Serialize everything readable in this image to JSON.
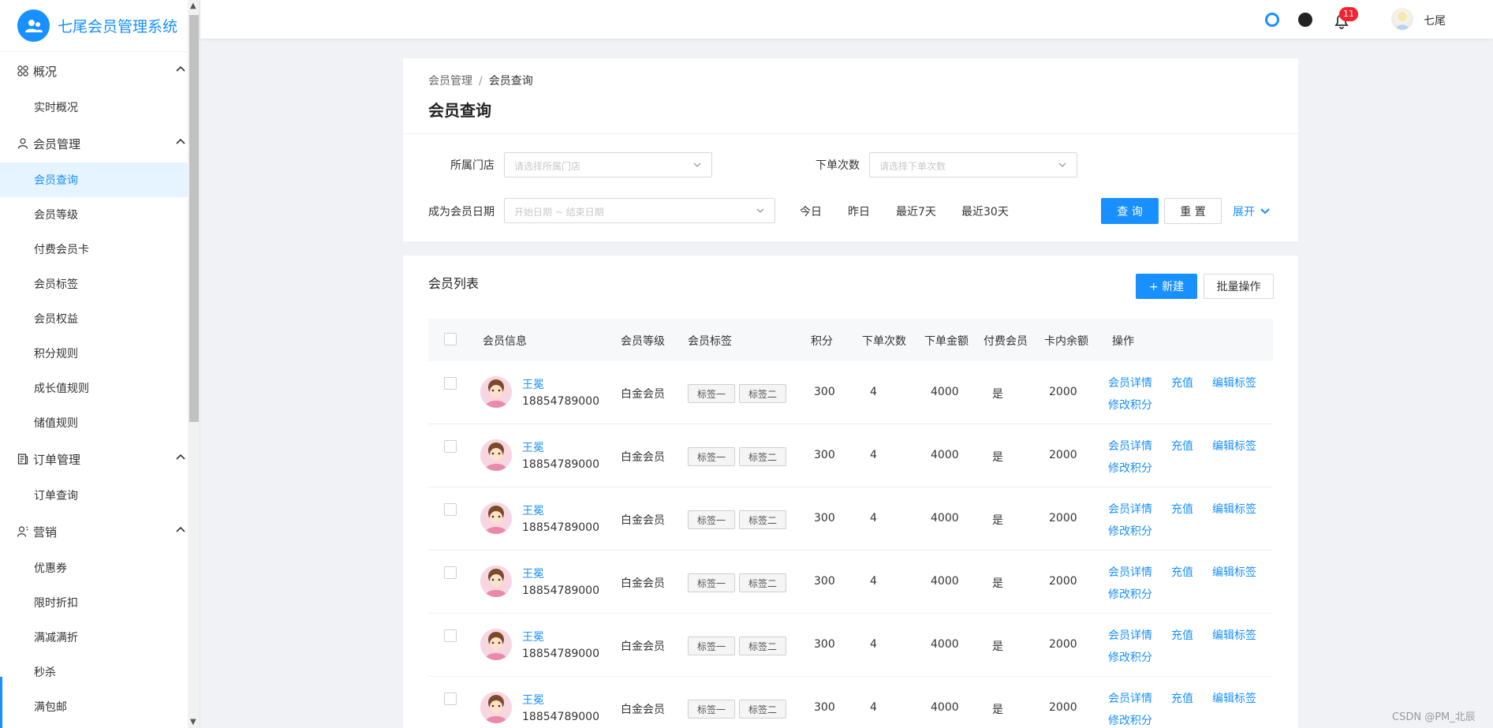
{
  "app": {
    "title": "七尾会员管理系统"
  },
  "sidebar": {
    "groups": [
      {
        "label": "概况",
        "icon": "grid-icon",
        "items": [
          "实时概况"
        ]
      },
      {
        "label": "会员管理",
        "icon": "user-icon",
        "items": [
          "会员查询",
          "会员等级",
          "付费会员卡",
          "会员标签",
          "会员权益",
          "积分规则",
          "成长值规则",
          "储值规则"
        ]
      },
      {
        "label": "订单管理",
        "icon": "order-icon",
        "items": [
          "订单查询"
        ]
      },
      {
        "label": "营销",
        "icon": "marketing-icon",
        "items": [
          "优惠券",
          "限时折扣",
          "满减满折",
          "秒杀",
          "满包邮"
        ]
      }
    ],
    "active_item": "会员查询"
  },
  "header": {
    "notification_count": "11",
    "username": "七尾"
  },
  "breadcrumb": {
    "parent": "会员管理",
    "separator": "/",
    "current": "会员查询"
  },
  "page": {
    "title": "会员查询"
  },
  "filters": {
    "store_label": "所属门店",
    "store_placeholder": "请选择所属门店",
    "orders_label": "下单次数",
    "orders_placeholder": "请选择下单次数",
    "date_label": "成为会员日期",
    "date_placeholder": "开始日期 ~ 结束日期",
    "quick": [
      "今日",
      "昨日",
      "最近7天",
      "最近30天"
    ],
    "query_button": "查 询",
    "reset_button": "重 置",
    "expand": "展开"
  },
  "list": {
    "title": "会员列表",
    "new_button": "+ 新建",
    "batch_button": "批量操作",
    "columns": [
      "会员信息",
      "会员等级",
      "会员标签",
      "积分",
      "下单次数",
      "下单金额",
      "付费会员",
      "卡内余额",
      "操作"
    ],
    "rows": [
      {
        "name": "王冕",
        "phone": "18854789000",
        "level": "白金会员",
        "tags": [
          "标签一",
          "标签二"
        ],
        "points": "300",
        "orders": "4",
        "amount": "4000",
        "paid": "是",
        "balance": "2000"
      },
      {
        "name": "王冕",
        "phone": "18854789000",
        "level": "白金会员",
        "tags": [
          "标签一",
          "标签二"
        ],
        "points": "300",
        "orders": "4",
        "amount": "4000",
        "paid": "是",
        "balance": "2000"
      },
      {
        "name": "王冕",
        "phone": "18854789000",
        "level": "白金会员",
        "tags": [
          "标签一",
          "标签二"
        ],
        "points": "300",
        "orders": "4",
        "amount": "4000",
        "paid": "是",
        "balance": "2000"
      },
      {
        "name": "王冕",
        "phone": "18854789000",
        "level": "白金会员",
        "tags": [
          "标签一",
          "标签二"
        ],
        "points": "300",
        "orders": "4",
        "amount": "4000",
        "paid": "是",
        "balance": "2000"
      },
      {
        "name": "王冕",
        "phone": "18854789000",
        "level": "白金会员",
        "tags": [
          "标签一",
          "标签二"
        ],
        "points": "300",
        "orders": "4",
        "amount": "4000",
        "paid": "是",
        "balance": "2000"
      },
      {
        "name": "王冕",
        "phone": "18854789000",
        "level": "白金会员",
        "tags": [
          "标签一",
          "标签二"
        ],
        "points": "300",
        "orders": "4",
        "amount": "4000",
        "paid": "是",
        "balance": "2000"
      }
    ],
    "actions": [
      "会员详情",
      "充值",
      "编辑标签",
      "修改积分"
    ]
  },
  "watermark": "CSDN @PM_北辰",
  "colors": {
    "accent": "#1890ff",
    "background": "#f0f2f5",
    "badge": "#f5222d"
  }
}
